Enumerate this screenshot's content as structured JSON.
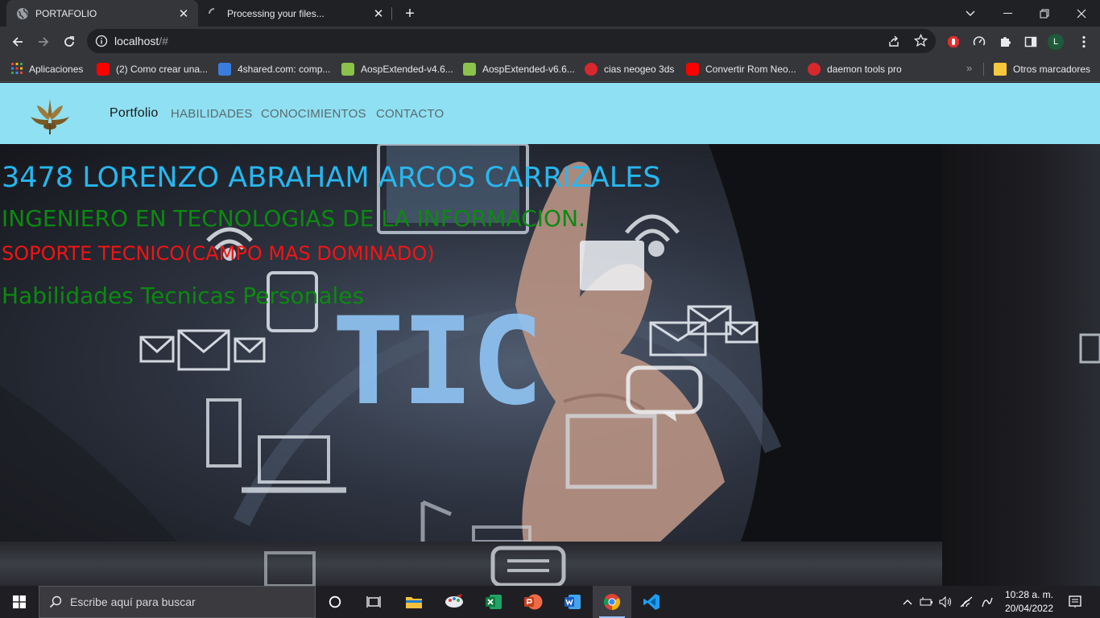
{
  "browser": {
    "tabs": [
      {
        "title": "PORTAFOLIO",
        "active": true,
        "icon": "globe-icon"
      },
      {
        "title": "Processing your files...",
        "active": false,
        "icon": "loading-spinner-icon"
      }
    ],
    "address": {
      "host": "localhost",
      "path": "/#"
    },
    "profile_initial": "L",
    "bookmarks": [
      {
        "label": "Aplicaciones",
        "icon": "apps-grid-icon"
      },
      {
        "label": "(2) Como crear una...",
        "icon": "youtube-icon",
        "color": "#ff0000"
      },
      {
        "label": "4shared.com: comp...",
        "icon": "4shared-icon",
        "color": "#3b7ddd"
      },
      {
        "label": "AospExtended-v4.6...",
        "icon": "android-icon",
        "color": "#8bc34a"
      },
      {
        "label": "AospExtended-v6.6...",
        "icon": "android-icon",
        "color": "#8bc34a"
      },
      {
        "label": "cias neogeo 3ds",
        "icon": "mega-icon",
        "color": "#d9272e"
      },
      {
        "label": "Convertir Rom Neo...",
        "icon": "youtube-icon",
        "color": "#ff0000"
      },
      {
        "label": "daemon tools pro",
        "icon": "mega-icon",
        "color": "#d9272e"
      }
    ],
    "bookmarks_more": "»",
    "other_bookmarks": "Otros marcadores"
  },
  "site": {
    "nav": {
      "brand": "Portfolio",
      "links": [
        "HABILIDADES",
        "CONOCIMIENTOS",
        "CONTACTO"
      ]
    },
    "hero": {
      "name": "3478 LORENZO ABRAHAM ARCOS CARRIZALES",
      "title": "INGENIERO EN TECNOLOGIAS DE LA INFORMACION.",
      "support": "SOPORTE TECNICO(CAMPO MAS DOMINADO)",
      "skills": "Habilidades Tecnicas Personales",
      "image_text": "TIC"
    },
    "colors": {
      "navbar": "#8fe0f2",
      "name": "#27b7ee",
      "green": "#0b8a10",
      "red": "#f21414"
    }
  },
  "taskbar": {
    "search_placeholder": "Escribe aquí para buscar",
    "apps": [
      "file-explorer-icon",
      "paint-icon",
      "excel-icon",
      "powerpoint-icon",
      "word-icon",
      "chrome-icon",
      "vscode-icon"
    ],
    "time": "10:28 a. m.",
    "date": "20/04/2022"
  }
}
